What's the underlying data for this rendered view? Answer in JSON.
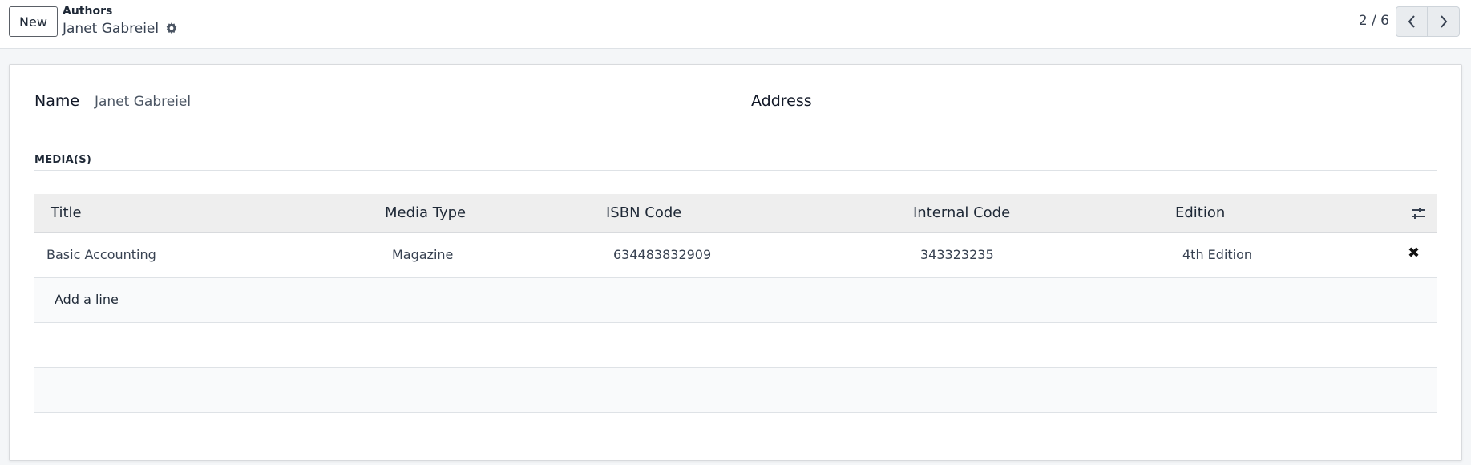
{
  "toolbar": {
    "new_label": "New",
    "breadcrumb_parent": "Authors",
    "breadcrumb_current": "Janet Gabreiel",
    "pager": "2 / 6"
  },
  "form": {
    "name_label": "Name",
    "name_value": "Janet Gabreiel",
    "address_label": "Address",
    "section_title": "MEDIA(S)"
  },
  "table": {
    "headers": [
      "Title",
      "Media Type",
      "ISBN Code",
      "Internal Code",
      "Edition"
    ],
    "rows": [
      {
        "title": "Basic Accounting",
        "media_type": "Magazine",
        "isbn": "634483832909",
        "internal_code": "343323235",
        "edition": "4th Edition"
      }
    ],
    "add_line_label": "Add a line",
    "delete_glyph": "✖"
  },
  "icons": {
    "settings": "gear-icon",
    "prev": "chevron-left-icon",
    "next": "chevron-right-icon",
    "optional_columns": "sliders-icon"
  }
}
